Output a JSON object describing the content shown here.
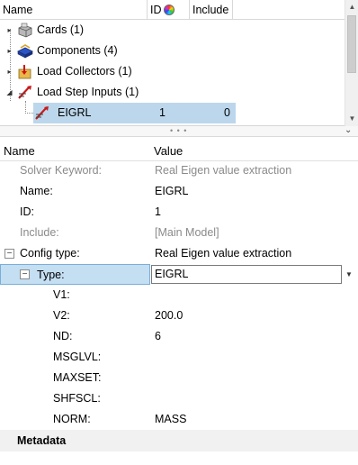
{
  "tree": {
    "columns": {
      "name": "Name",
      "id": "ID",
      "include": "Include"
    },
    "items": [
      {
        "label": "Cards (1)",
        "icon": "cards-icon"
      },
      {
        "label": "Components (4)",
        "icon": "components-icon"
      },
      {
        "label": "Load Collectors (1)",
        "icon": "load-collectors-icon"
      },
      {
        "label": "Load Step Inputs (1)",
        "icon": "load-step-inputs-icon"
      }
    ],
    "selected": {
      "label": "EIGRL",
      "id": "1",
      "include": "0",
      "icon": "eigrl-icon"
    }
  },
  "splitter": {
    "dots": "• • •",
    "collapse": "⌄"
  },
  "props": {
    "header": {
      "name": "Name",
      "value": "Value"
    },
    "solver_keyword": {
      "key": "Solver Keyword:",
      "value": "Real Eigen value extraction"
    },
    "name": {
      "key": "Name:",
      "value": "EIGRL"
    },
    "id": {
      "key": "ID:",
      "value": "1"
    },
    "include": {
      "key": "Include:",
      "value": "[Main Model]"
    },
    "config_type": {
      "key": "Config type:",
      "value": "Real Eigen value extraction"
    },
    "type": {
      "key": "Type:",
      "value": "EIGRL"
    },
    "v1": {
      "key": "V1:",
      "value": ""
    },
    "v2": {
      "key": "V2:",
      "value": "200.0"
    },
    "nd": {
      "key": "ND:",
      "value": "6"
    },
    "msglvl": {
      "key": "MSGLVL:",
      "value": ""
    },
    "maxset": {
      "key": "MAXSET:",
      "value": ""
    },
    "shfscl": {
      "key": "SHFSCL:",
      "value": ""
    },
    "norm": {
      "key": "NORM:",
      "value": "MASS"
    },
    "metadata": "Metadata"
  }
}
